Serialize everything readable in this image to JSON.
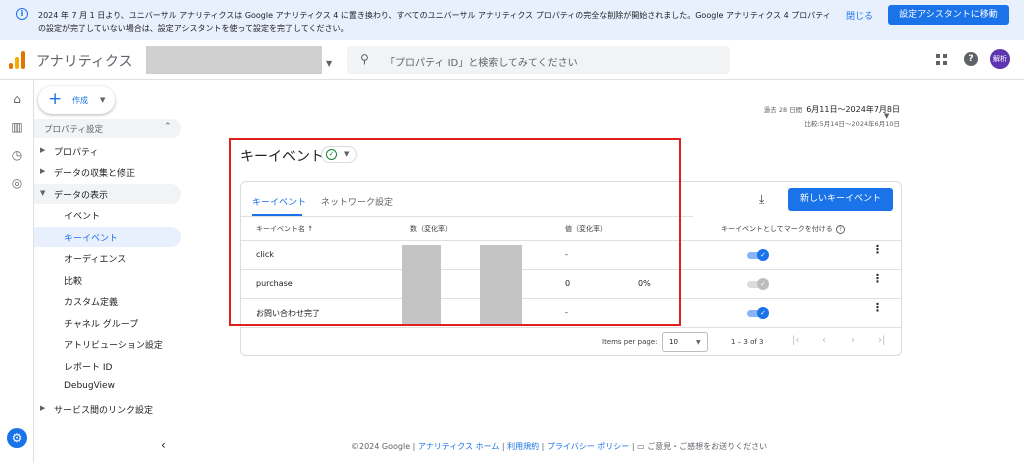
{
  "banner": {
    "message": "2024 年 7 月 1 日より、ユニバーサル アナリティクスは Google アナリティクス 4 に置き換わり、すべてのユニバーサル アナリティクス プロパティの完全な削除が開始されました。Google アナリティクス 4 プロパティの設定が完了していない場合は、設定アシスタントを使って設定を完了してください。",
    "close_label": "閉じる",
    "button_label": "設定アシスタントに移動"
  },
  "header": {
    "app_title": "アナリティクス",
    "search_placeholder": "「プロパティ ID」と検索してみてください",
    "avatar_text": "解析"
  },
  "sidebar": {
    "create_label": "作成",
    "section_title": "プロパティ設定",
    "items": [
      {
        "label": "プロパティ",
        "level": 1
      },
      {
        "label": "データの収集と修正",
        "level": 1
      },
      {
        "label": "データの表示",
        "level": 1
      },
      {
        "label": "イベント",
        "level": 2
      },
      {
        "label": "キーイベント",
        "level": 2
      },
      {
        "label": "オーディエンス",
        "level": 2
      },
      {
        "label": "比較",
        "level": 2
      },
      {
        "label": "カスタム定義",
        "level": 2
      },
      {
        "label": "チャネル グループ",
        "level": 2
      },
      {
        "label": "アトリビューション設定",
        "level": 2
      },
      {
        "label": "レポート ID",
        "level": 2
      },
      {
        "label": "DebugView",
        "level": 2
      },
      {
        "label": "サービス間のリンク設定",
        "level": 1
      }
    ]
  },
  "date_range": {
    "prefix": "過去 28 日間",
    "range": "6月11日～2024年7月8日",
    "compare": "比較:5月14日～2024年6月10日"
  },
  "page": {
    "title": "キーイベント"
  },
  "card": {
    "tabs": [
      "キーイベント",
      "ネットワーク設定"
    ],
    "new_button": "新しいキーイベント",
    "columns": {
      "name": "キーイベント名 ↑",
      "count": "数（変化率）",
      "value": "値（変化率）",
      "mark": "キーイベントとしてマークを付ける"
    },
    "rows": [
      {
        "name": "click",
        "value": "-",
        "change": "",
        "marked": true
      },
      {
        "name": "purchase",
        "value": "0",
        "change": "0%",
        "marked": false
      },
      {
        "name": "お問い合わせ完了",
        "value": "-",
        "change": "",
        "marked": true
      }
    ],
    "pager": {
      "items_label": "Items per page:",
      "per_page": "10",
      "range": "1 – 3 of 3"
    }
  },
  "footer": {
    "copyright": "©2024 Google",
    "links": [
      "アナリティクス ホーム",
      "利用規約",
      "プライバシー ポリシー"
    ],
    "feedback": "ご意見・ご感想をお送りください"
  },
  "colors": {
    "accent": "#1a73e8",
    "highlight_box": "#e0201c"
  }
}
